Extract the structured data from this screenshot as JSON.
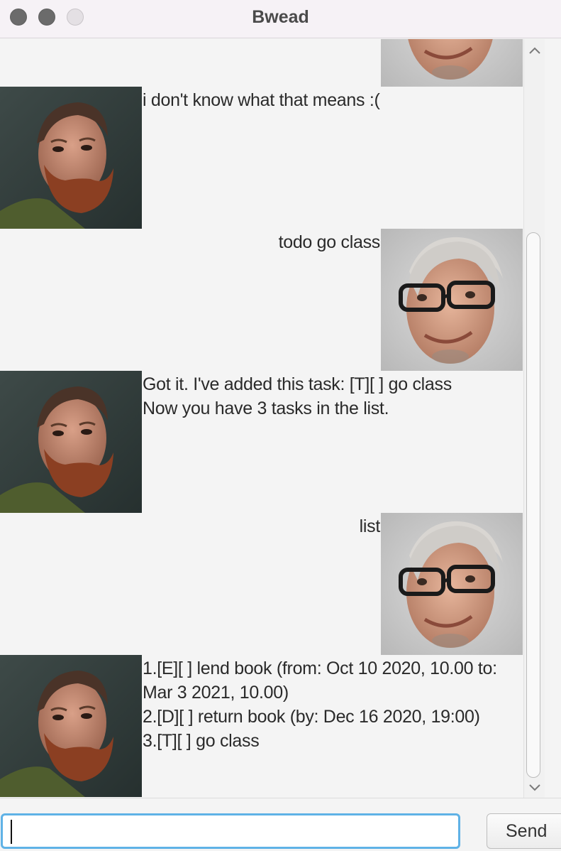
{
  "window": {
    "title": "Bwead"
  },
  "chat": {
    "messages": [
      {
        "sender": "user",
        "avatar": "user-avatar",
        "text": ""
      },
      {
        "sender": "bot",
        "avatar": "bot-avatar",
        "text": "i don't know what that means :("
      },
      {
        "sender": "user",
        "avatar": "user-avatar",
        "text": "todo go class"
      },
      {
        "sender": "bot",
        "avatar": "bot-avatar",
        "text": "Got it. I've added this task: [T][ ] go class\nNow you have 3 tasks in the list."
      },
      {
        "sender": "user",
        "avatar": "user-avatar",
        "text": "list"
      },
      {
        "sender": "bot",
        "avatar": "bot-avatar",
        "text": "1.[E][ ] lend book (from: Oct 10 2020, 10.00 to: Mar 3 2021, 10.00)\n2.[D][ ] return book (by: Dec 16 2020, 19:00)\n3.[T][ ] go class"
      }
    ]
  },
  "input": {
    "value": "",
    "placeholder": ""
  },
  "send_button": {
    "label": "Send"
  },
  "colors": {
    "input_focus": "#5fb2e6",
    "background": "#f4f4f4"
  }
}
